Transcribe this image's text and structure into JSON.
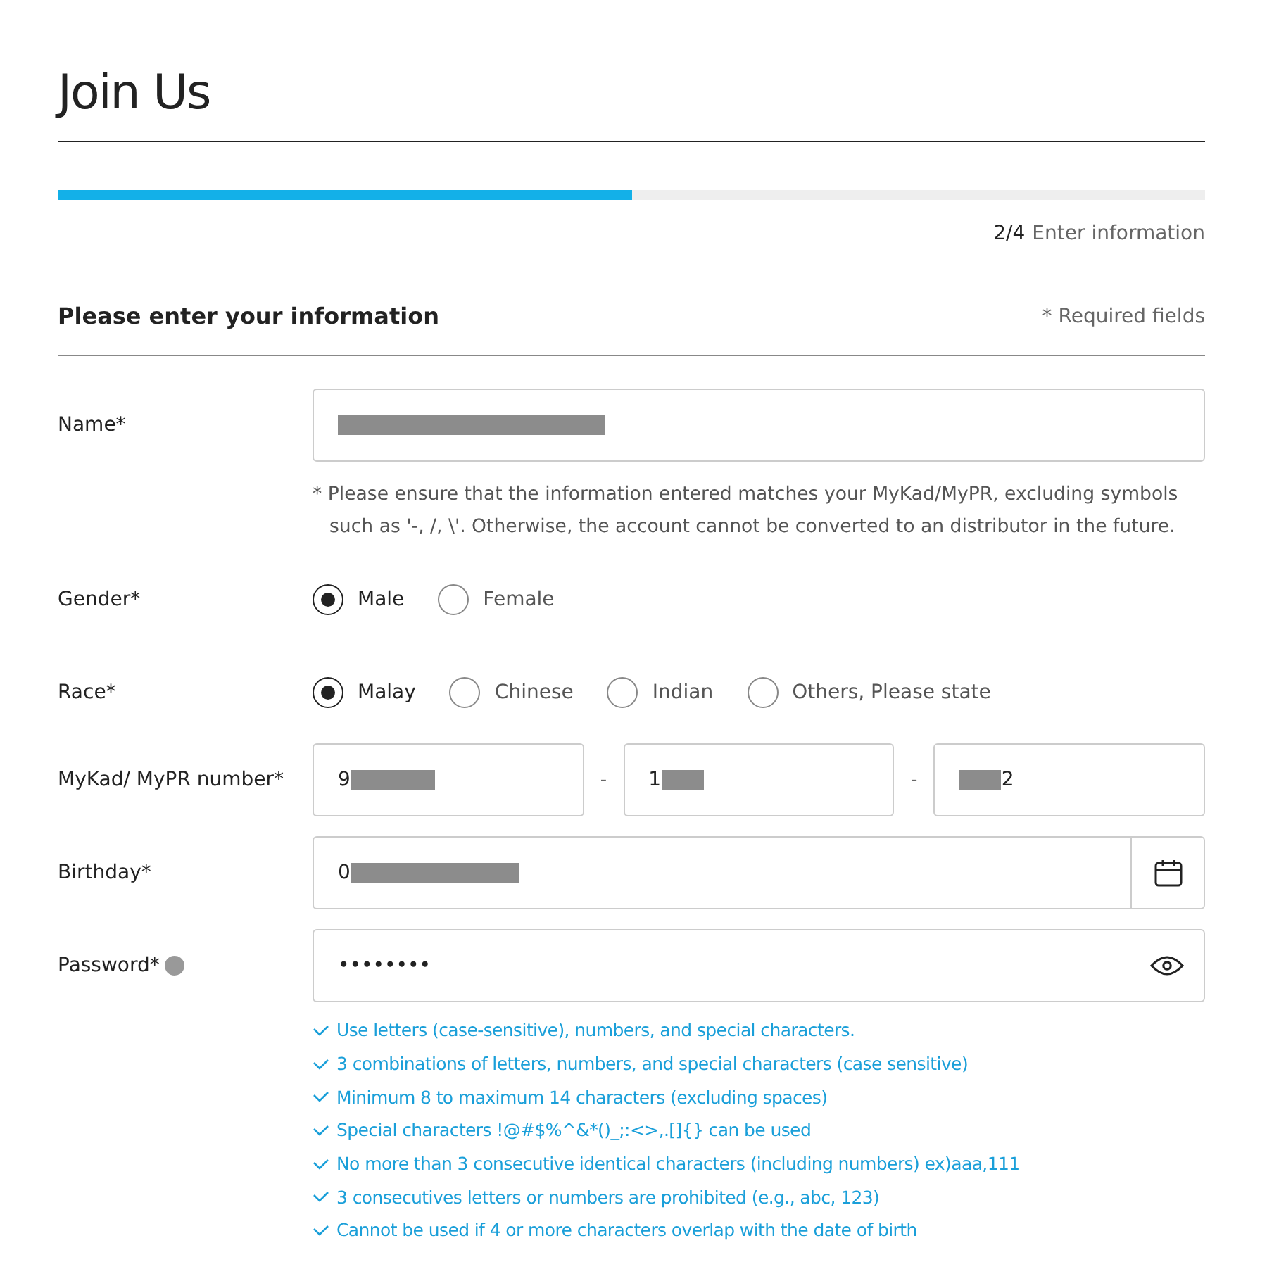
{
  "title": "Join Us",
  "progress": {
    "level": 0.5,
    "step": "2/4",
    "step_label": "Enter information"
  },
  "section": {
    "heading": "Please enter your information",
    "required_note": "* Required fields"
  },
  "fields": [
    {
      "kind": "text",
      "label": "Name*",
      "redacted": true,
      "note": "* Please ensure that the information entered matches your MyKad/MyPR, excluding symbols such as '-, /, \\'. Otherwise, the account cannot be converted to an distributor in the future."
    },
    {
      "kind": "radio",
      "label": "Gender*",
      "options": [
        {
          "label": "Male",
          "selected": true
        },
        {
          "label": "Female",
          "selected": false
        }
      ]
    },
    {
      "kind": "radio",
      "label": "Race*",
      "options": [
        {
          "label": "Malay",
          "selected": true
        },
        {
          "label": "Chinese",
          "selected": false
        },
        {
          "label": "Indian",
          "selected": false
        },
        {
          "label": "Others, Please state",
          "selected": false
        }
      ]
    },
    {
      "kind": "split",
      "label": "MyKad/ MyPR number*",
      "separator": "-",
      "parts": [
        {
          "value_start": "9",
          "redacted": true
        },
        {
          "value_start": "1",
          "redacted": true
        },
        {
          "redacted": true,
          "value_end": "2"
        }
      ]
    },
    {
      "kind": "date",
      "label": "Birthday*",
      "value_start": "0",
      "redacted": true
    },
    {
      "kind": "password",
      "label": "Password*",
      "info": true,
      "value_start": "••••••••",
      "rules": [
        "Use letters (case-sensitive), numbers, and special characters.",
        "3 combinations of letters, numbers, and special characters (case sensitive)",
        "Minimum 8 to maximum 14 characters (excluding spaces)",
        "Special characters !@#$%^&*()_;:<>,.[]{} can be used",
        "No more than 3 consecutive identical characters (including numbers) ex)aaa,111",
        "3 consecutives letters or numbers are prohibited (e.g., abc, 123)",
        "Cannot be used if 4 or more characters overlap with the date of birth"
      ]
    }
  ]
}
